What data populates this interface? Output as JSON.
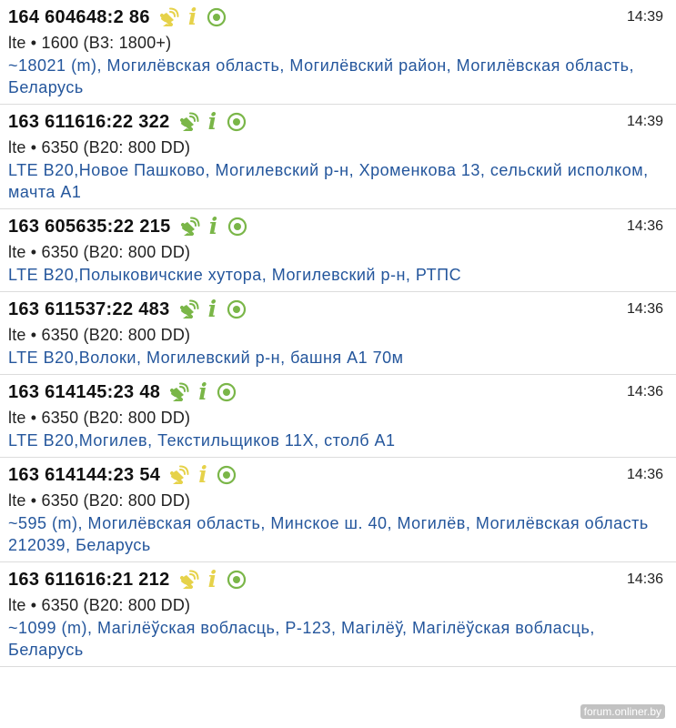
{
  "colors": {
    "title": "#111111",
    "address": "#24569c",
    "icon_green": "#7ab648",
    "icon_yellow": "#e6d24a"
  },
  "cells": [
    {
      "id": "164 604648:2 86",
      "time": "14:39",
      "tech": "lte • 1600 (B3: 1800+)",
      "address": "~18021 (m), Могилёвская область, Могилёвский район, Могилёвская область, Беларусь",
      "icon_color": "yellow"
    },
    {
      "id": "163 611616:22 322",
      "time": "14:39",
      "tech": "lte • 6350 (B20: 800 DD)",
      "address": "LTE B20,Новое Пашково, Могилевский р-н, Хроменкова 13, сельский исполком, мачта А1",
      "icon_color": "green"
    },
    {
      "id": "163 605635:22 215",
      "time": "14:36",
      "tech": "lte • 6350 (B20: 800 DD)",
      "address": "LTE B20,Полыковичские хутора, Могилевский р-н, РТПС",
      "icon_color": "green"
    },
    {
      "id": "163 611537:22 483",
      "time": "14:36",
      "tech": "lte • 6350 (B20: 800 DD)",
      "address": "LTE B20,Волоки, Могилевский р-н, башня А1 70м",
      "icon_color": "green"
    },
    {
      "id": "163 614145:23 48",
      "time": "14:36",
      "tech": "lte • 6350 (B20: 800 DD)",
      "address": "LTE B20,Могилев, Текстильщиков 11Х, столб А1",
      "icon_color": "green"
    },
    {
      "id": "163 614144:23 54",
      "time": "14:36",
      "tech": "lte • 6350 (B20: 800 DD)",
      "address": "~595 (m), Могилёвская область, Минское ш. 40, Могилёв, Могилёвская область 212039, Беларусь",
      "icon_color": "yellow"
    },
    {
      "id": "163 611616:21 212",
      "time": "14:36",
      "tech": "lte • 6350 (B20: 800 DD)",
      "address": "~1099 (m), Магілёўская вобласць, Р-123, Магілёў, Магілёўская вобласць, Беларусь",
      "icon_color": "yellow"
    }
  ],
  "icons": [
    "antenna-icon",
    "info-icon",
    "target-icon"
  ],
  "watermark": "forum.onliner.by"
}
